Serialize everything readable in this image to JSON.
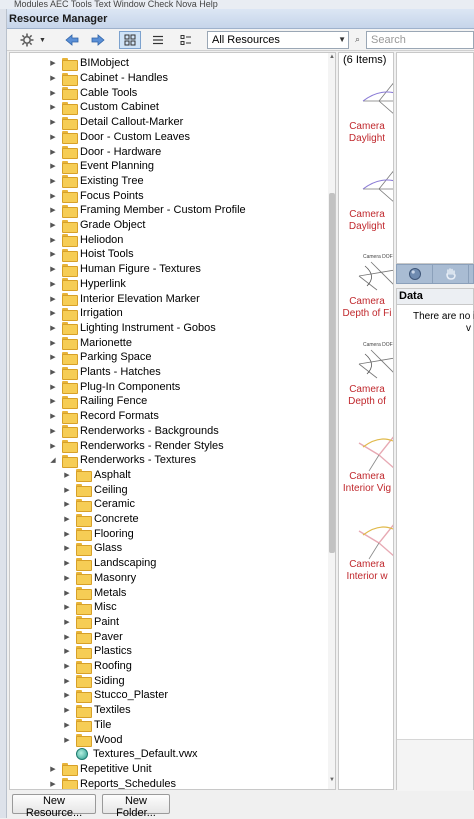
{
  "menubar": {
    "text": "Modules   AEC   Tools   Text   Window   Check   Nova   Help"
  },
  "window": {
    "title": "Resource Manager"
  },
  "toolbar": {
    "filter_value": "All Resources",
    "search_placeholder": "Search"
  },
  "tree": {
    "items": [
      {
        "label": "BIMobject",
        "level": 0,
        "type": "folder",
        "expanded": false
      },
      {
        "label": "Cabinet - Handles",
        "level": 0,
        "type": "folder",
        "expanded": false
      },
      {
        "label": "Cable Tools",
        "level": 0,
        "type": "folder",
        "expanded": false
      },
      {
        "label": "Custom Cabinet",
        "level": 0,
        "type": "folder",
        "expanded": false
      },
      {
        "label": "Detail Callout-Marker",
        "level": 0,
        "type": "folder",
        "expanded": false
      },
      {
        "label": "Door - Custom Leaves",
        "level": 0,
        "type": "folder",
        "expanded": false
      },
      {
        "label": "Door - Hardware",
        "level": 0,
        "type": "folder",
        "expanded": false
      },
      {
        "label": "Event Planning",
        "level": 0,
        "type": "folder",
        "expanded": false
      },
      {
        "label": "Existing Tree",
        "level": 0,
        "type": "folder",
        "expanded": false
      },
      {
        "label": "Focus Points",
        "level": 0,
        "type": "folder",
        "expanded": false
      },
      {
        "label": "Framing Member - Custom Profile",
        "level": 0,
        "type": "folder",
        "expanded": false
      },
      {
        "label": "Grade Object",
        "level": 0,
        "type": "folder",
        "expanded": false
      },
      {
        "label": "Heliodon",
        "level": 0,
        "type": "folder",
        "expanded": false
      },
      {
        "label": "Hoist Tools",
        "level": 0,
        "type": "folder",
        "expanded": false
      },
      {
        "label": "Human Figure - Textures",
        "level": 0,
        "type": "folder",
        "expanded": false
      },
      {
        "label": "Hyperlink",
        "level": 0,
        "type": "folder",
        "expanded": false
      },
      {
        "label": "Interior Elevation Marker",
        "level": 0,
        "type": "folder",
        "expanded": false
      },
      {
        "label": "Irrigation",
        "level": 0,
        "type": "folder",
        "expanded": false
      },
      {
        "label": "Lighting Instrument - Gobos",
        "level": 0,
        "type": "folder",
        "expanded": false
      },
      {
        "label": "Marionette",
        "level": 0,
        "type": "folder",
        "expanded": false
      },
      {
        "label": "Parking Space",
        "level": 0,
        "type": "folder",
        "expanded": false
      },
      {
        "label": "Plants - Hatches",
        "level": 0,
        "type": "folder",
        "expanded": false
      },
      {
        "label": "Plug-In Components",
        "level": 0,
        "type": "folder",
        "expanded": false
      },
      {
        "label": "Railing Fence",
        "level": 0,
        "type": "folder",
        "expanded": false
      },
      {
        "label": "Record Formats",
        "level": 0,
        "type": "folder",
        "expanded": false
      },
      {
        "label": "Renderworks - Backgrounds",
        "level": 0,
        "type": "folder",
        "expanded": false
      },
      {
        "label": "Renderworks - Render Styles",
        "level": 0,
        "type": "folder",
        "expanded": false
      },
      {
        "label": "Renderworks - Textures",
        "level": 0,
        "type": "folder",
        "expanded": true
      },
      {
        "label": "Asphalt",
        "level": 1,
        "type": "folder",
        "expanded": false
      },
      {
        "label": "Ceiling",
        "level": 1,
        "type": "folder",
        "expanded": false
      },
      {
        "label": "Ceramic",
        "level": 1,
        "type": "folder",
        "expanded": false
      },
      {
        "label": "Concrete",
        "level": 1,
        "type": "folder",
        "expanded": false
      },
      {
        "label": "Flooring",
        "level": 1,
        "type": "folder",
        "expanded": false
      },
      {
        "label": "Glass",
        "level": 1,
        "type": "folder",
        "expanded": false
      },
      {
        "label": "Landscaping",
        "level": 1,
        "type": "folder",
        "expanded": false
      },
      {
        "label": "Masonry",
        "level": 1,
        "type": "folder",
        "expanded": false
      },
      {
        "label": "Metals",
        "level": 1,
        "type": "folder",
        "expanded": false
      },
      {
        "label": "Misc",
        "level": 1,
        "type": "folder",
        "expanded": false
      },
      {
        "label": "Paint",
        "level": 1,
        "type": "folder",
        "expanded": false
      },
      {
        "label": "Paver",
        "level": 1,
        "type": "folder",
        "expanded": false
      },
      {
        "label": "Plastics",
        "level": 1,
        "type": "folder",
        "expanded": false
      },
      {
        "label": "Roofing",
        "level": 1,
        "type": "folder",
        "expanded": false
      },
      {
        "label": "Siding",
        "level": 1,
        "type": "folder",
        "expanded": false
      },
      {
        "label": "Stucco_Plaster",
        "level": 1,
        "type": "folder",
        "expanded": false
      },
      {
        "label": "Textiles",
        "level": 1,
        "type": "folder",
        "expanded": false
      },
      {
        "label": "Tile",
        "level": 1,
        "type": "folder",
        "expanded": false
      },
      {
        "label": "Wood",
        "level": 1,
        "type": "folder",
        "expanded": false
      },
      {
        "label": "Textures_Default.vwx",
        "level": 1,
        "type": "file",
        "expanded": false
      },
      {
        "label": "Repetitive Unit",
        "level": 0,
        "type": "folder",
        "expanded": false
      },
      {
        "label": "Reports_Schedules",
        "level": 0,
        "type": "folder",
        "expanded": false
      }
    ]
  },
  "resources": {
    "count_label": "(6 Items)",
    "items": [
      {
        "line1": "Camera",
        "line2": "Daylight",
        "icon": "camera-daylight-icon"
      },
      {
        "line1": "Camera",
        "line2": "Daylight",
        "icon": "camera-daylight-icon"
      },
      {
        "line1": "Camera",
        "line2": "Depth of Fi",
        "icon": "camera-depth-of-field-icon"
      },
      {
        "line1": "Camera",
        "line2": "Depth of",
        "icon": "camera-depth-of-field-icon"
      },
      {
        "line1": "Camera",
        "line2": "Interior Vig",
        "icon": "camera-interior-icon"
      },
      {
        "line1": "Camera",
        "line2": "Interior w",
        "icon": "camera-interior-icon"
      }
    ]
  },
  "data_panel": {
    "title": "Data",
    "message_line1": "There are no ite",
    "message_line2": "v"
  },
  "buttons": {
    "new_resource": "New Resource...",
    "new_folder": "New Folder..."
  },
  "colors": {
    "resource_label": "#c0282d",
    "folder": "#f6cd55",
    "title_bar": "#c6d5ea"
  }
}
